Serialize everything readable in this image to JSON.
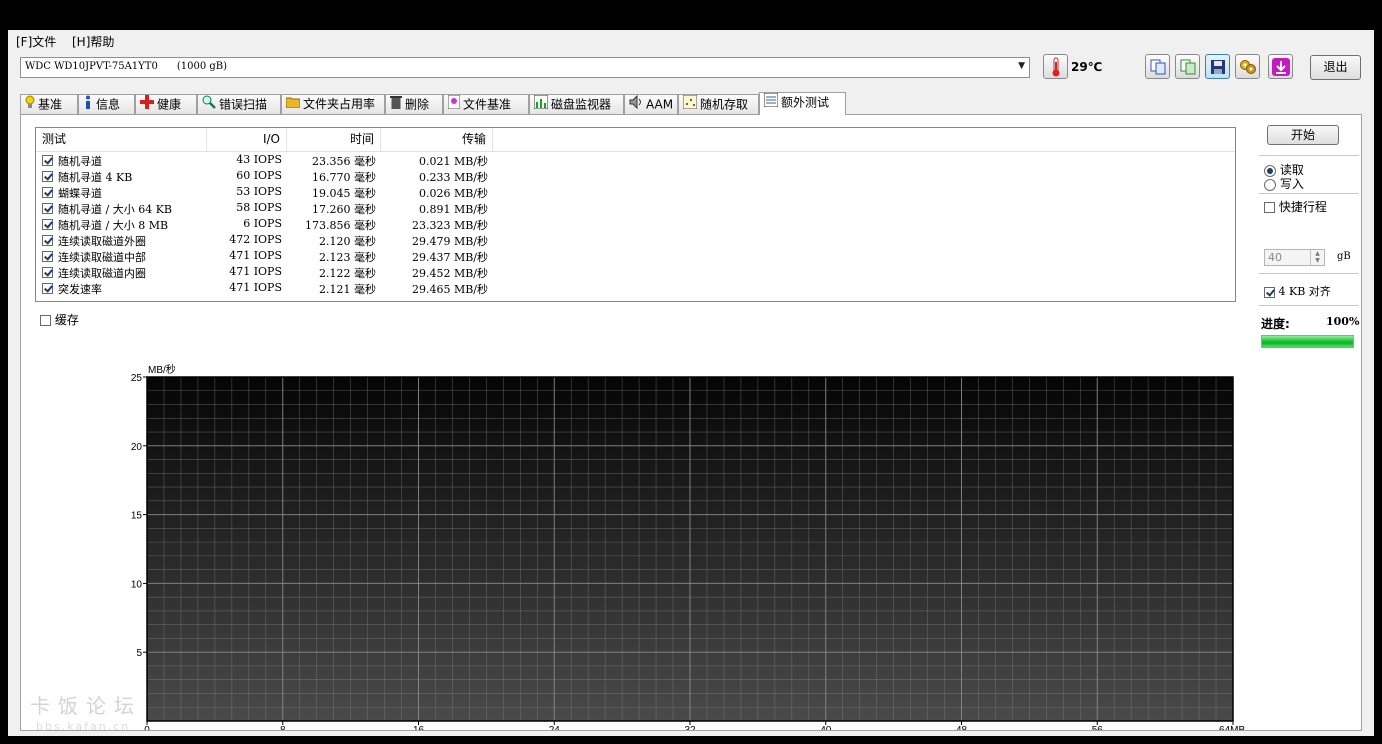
{
  "menu": {
    "file": "[F]文件",
    "help": "[H]帮助"
  },
  "drive": {
    "selected": "WDC WD10JPVT-75A1YT0      (1000 gB)"
  },
  "temperature": "29℃",
  "toolbar": {
    "exit_label": "退出"
  },
  "tabs": [
    {
      "label": "基准",
      "icon": "bulb-icon"
    },
    {
      "label": "信息",
      "icon": "info-icon"
    },
    {
      "label": "健康",
      "icon": "health-cross-icon"
    },
    {
      "label": "错误扫描",
      "icon": "magnifier-icon"
    },
    {
      "label": "文件夹占用率",
      "icon": "folder-icon"
    },
    {
      "label": "删除",
      "icon": "trash-icon"
    },
    {
      "label": "文件基准",
      "icon": "file-bench-icon"
    },
    {
      "label": "磁盘监视器",
      "icon": "monitor-chart-icon"
    },
    {
      "label": "AAM",
      "icon": "speaker-icon"
    },
    {
      "label": "随机存取",
      "icon": "random-access-icon"
    },
    {
      "label": "额外测试",
      "icon": "extra-tests-icon",
      "active": true
    }
  ],
  "results": {
    "headers": {
      "test": "测试",
      "io": "I/O",
      "time": "时间",
      "transfer": "传输"
    },
    "rows": [
      {
        "checked": true,
        "test": "随机寻道",
        "io": "43 IOPS",
        "time": "23.356 毫秒",
        "transfer": "0.021 MB/秒"
      },
      {
        "checked": true,
        "test": "随机寻道 4 KB",
        "io": "60 IOPS",
        "time": "16.770 毫秒",
        "transfer": "0.233 MB/秒"
      },
      {
        "checked": true,
        "test": "蝴蝶寻道",
        "io": "53 IOPS",
        "time": "19.045 毫秒",
        "transfer": "0.026 MB/秒"
      },
      {
        "checked": true,
        "test": "随机寻道 / 大小 64 KB",
        "io": "58 IOPS",
        "time": "17.260 毫秒",
        "transfer": "0.891 MB/秒"
      },
      {
        "checked": true,
        "test": "随机寻道 / 大小 8 MB",
        "io": "6 IOPS",
        "time": "173.856 毫秒",
        "transfer": "23.323 MB/秒"
      },
      {
        "checked": true,
        "test": "连续读取磁道外圈",
        "io": "472 IOPS",
        "time": "2.120 毫秒",
        "transfer": "29.479 MB/秒"
      },
      {
        "checked": true,
        "test": "连续读取磁道中部",
        "io": "471 IOPS",
        "time": "2.123 毫秒",
        "transfer": "29.437 MB/秒"
      },
      {
        "checked": true,
        "test": "连续读取磁道内圈",
        "io": "471 IOPS",
        "time": "2.122 毫秒",
        "transfer": "29.452 MB/秒"
      },
      {
        "checked": true,
        "test": "突发速率",
        "io": "471 IOPS",
        "time": "2.121 毫秒",
        "transfer": "29.465 MB/秒"
      }
    ]
  },
  "cache": {
    "label": "缓存",
    "checked": false
  },
  "side": {
    "start_label": "开始",
    "read_label": "读取",
    "read_selected": true,
    "write_label": "写入",
    "write_selected": false,
    "short_stroke_label": "快捷行程",
    "short_stroke_checked": false,
    "short_stroke_value": "40",
    "short_stroke_unit": "gB",
    "align_label": "4 KB 对齐",
    "align_checked": true,
    "progress_label": "进度:",
    "progress_value": "100%",
    "progress_fraction": 1.0
  },
  "watermark": {
    "main": "卡饭论坛",
    "sub": "bbs.kafan.cn"
  },
  "chart_data": {
    "type": "line",
    "ylabel": "MB/秒",
    "x_ticks": [
      "0",
      "8",
      "16",
      "24",
      "32",
      "40",
      "48",
      "56",
      "64MB"
    ],
    "y_ticks": [
      "5",
      "10",
      "15",
      "20",
      "25"
    ],
    "xlim": [
      0,
      64
    ],
    "ylim": [
      0,
      25
    ],
    "grid": true,
    "series": []
  }
}
